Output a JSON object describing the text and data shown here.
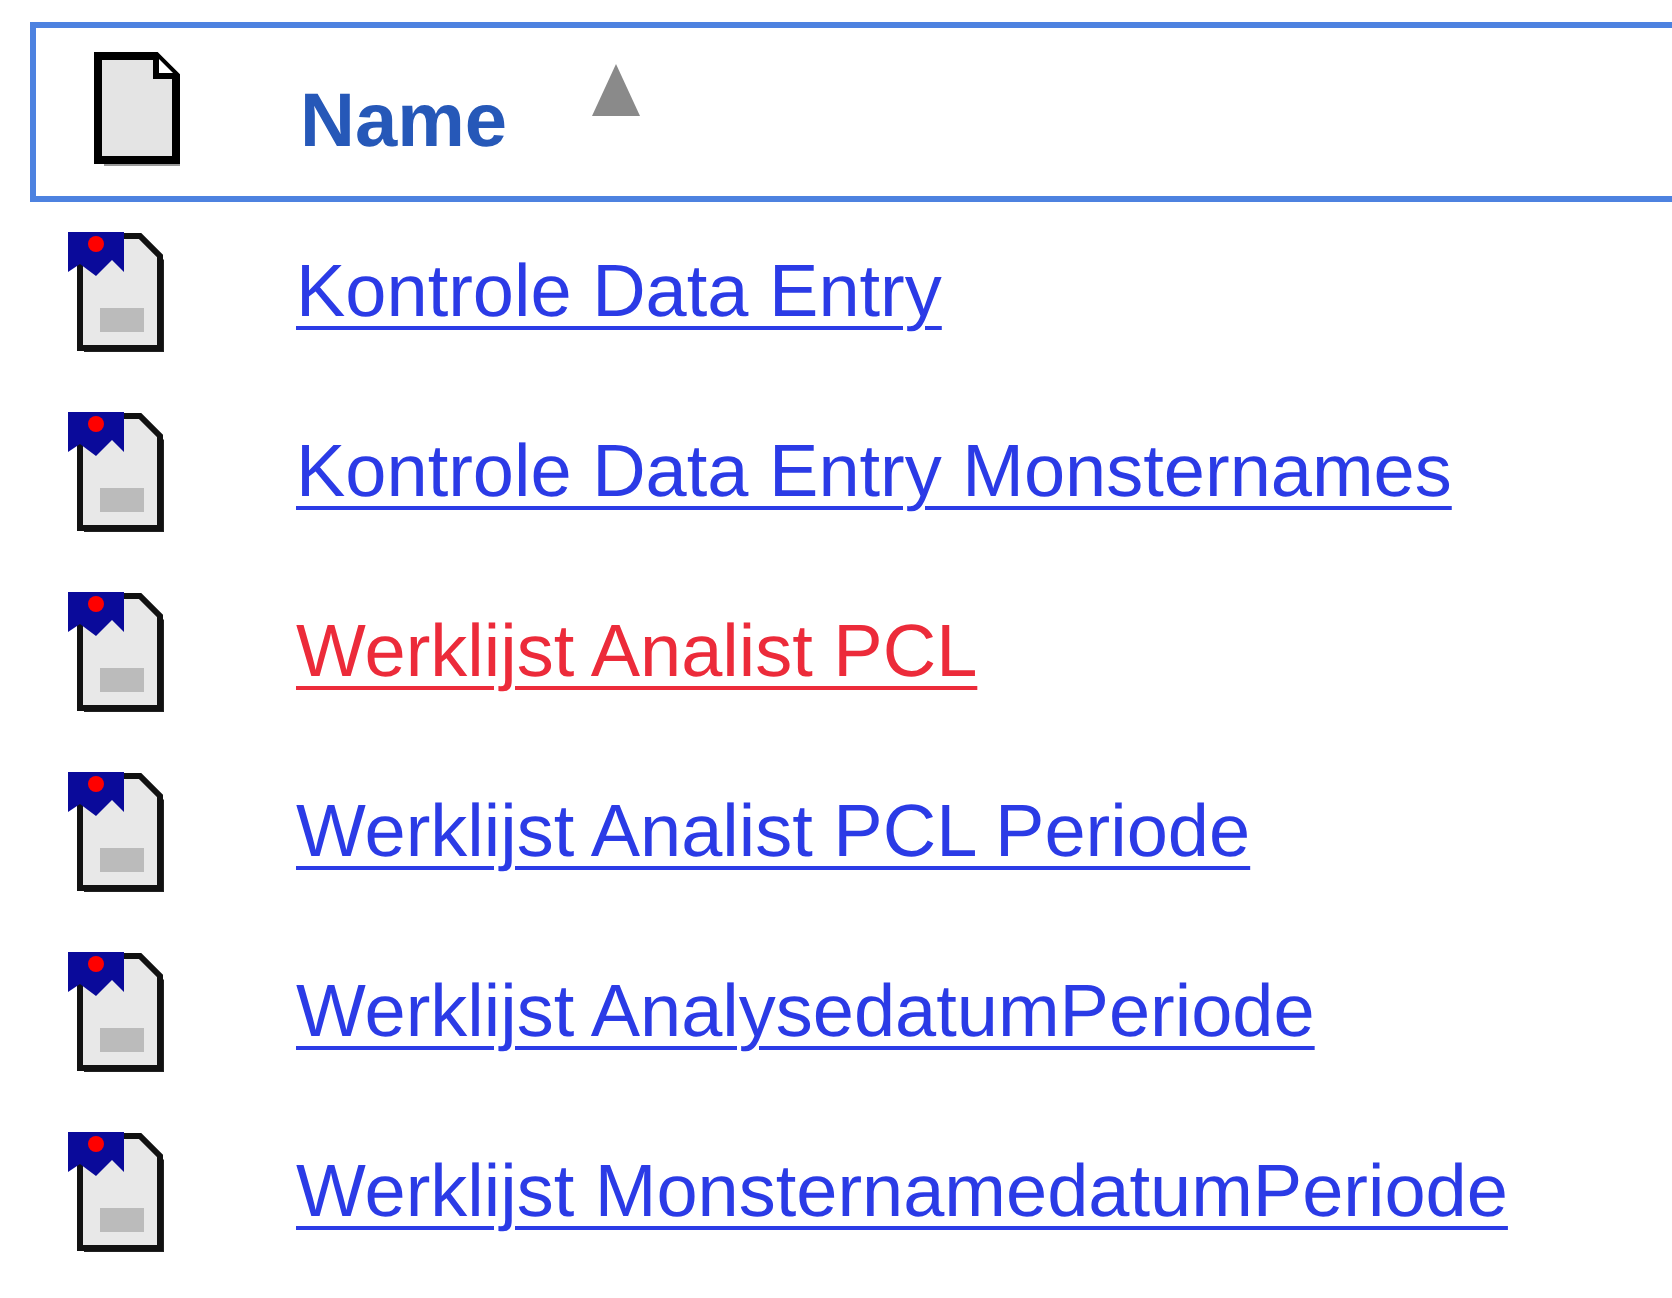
{
  "header": {
    "column": "Name",
    "sort_ascending": true
  },
  "files": [
    {
      "name": "Kontrole Data Entry",
      "selected": false
    },
    {
      "name": "Kontrole Data Entry Monsternames",
      "selected": false
    },
    {
      "name": "Werklijst Analist PCL",
      "selected": true
    },
    {
      "name": "Werklijst Analist PCL Periode",
      "selected": false
    },
    {
      "name": "Werklijst AnalysedatumPeriode",
      "selected": false
    },
    {
      "name": "Werklijst MonsternamedatumPeriode",
      "selected": false
    }
  ]
}
